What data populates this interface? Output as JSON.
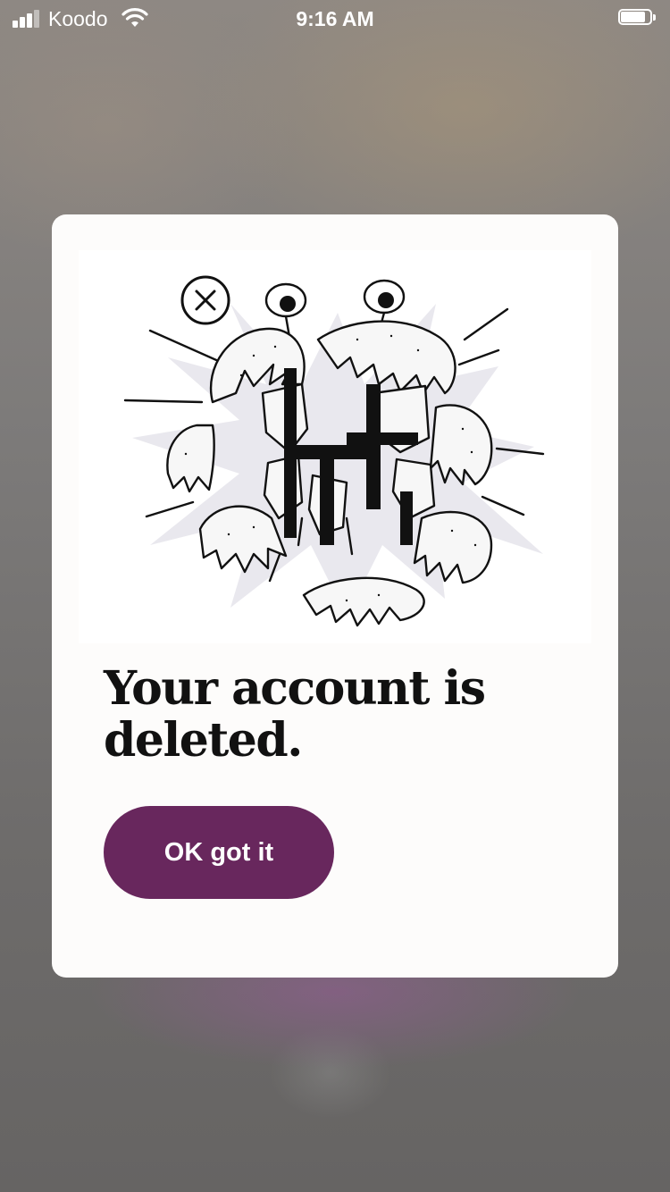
{
  "status_bar": {
    "carrier": "Koodo",
    "time": "9:16 AM",
    "signal_bars": 3,
    "signal_bars_total": 4,
    "battery_level": 0.85
  },
  "modal": {
    "illustration_icon": "exploding-monster-illustration",
    "title": "Your account is deleted.",
    "ok_button_label": "OK got it"
  },
  "colors": {
    "button": "#68275d",
    "card": "#fdfcfb",
    "title_text": "#111111"
  }
}
